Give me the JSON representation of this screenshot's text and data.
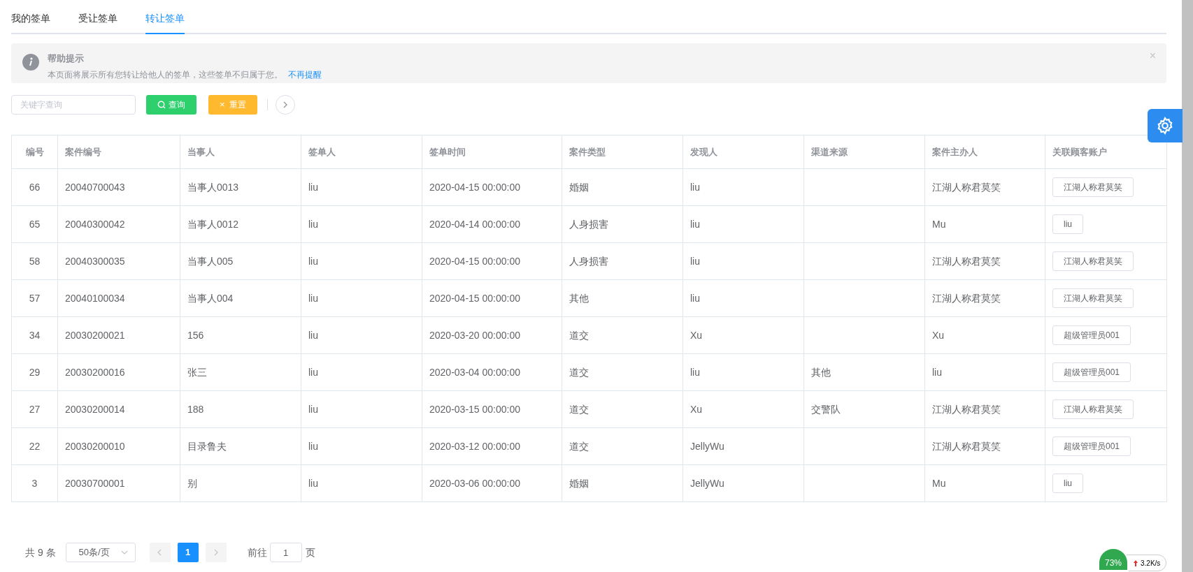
{
  "tabs": [
    {
      "label": "我的签单",
      "selected": false
    },
    {
      "label": "受让签单",
      "selected": false
    },
    {
      "label": "转让签单",
      "selected": true
    }
  ],
  "help_alert": {
    "title": "帮助提示",
    "message": "本页面将展示所有您转让给他人的签单，这些签单不归属于您。",
    "link": "不再提醒",
    "close": "×"
  },
  "toolbar": {
    "search": {
      "placeholder": "关键字查询"
    },
    "query_button": "查询",
    "reset_button": "重置",
    "reset_icon": "×"
  },
  "table": {
    "columns": [
      "编号",
      "案件编号",
      "当事人",
      "签单人",
      "签单时间",
      "案件类型",
      "发现人",
      "渠道来源",
      "案件主办人",
      "关联顾客账户"
    ],
    "rows": [
      [
        "66",
        "20040700043",
        "当事人0013",
        "liu",
        "2020-04-15 00:00:00",
        "婚姻",
        "liu",
        "",
        "江湖人称君莫笑",
        "江湖人称君莫笑"
      ],
      [
        "65",
        "20040300042",
        "当事人0012",
        "liu",
        "2020-04-14 00:00:00",
        "人身损害",
        "liu",
        "",
        "Mu",
        "liu"
      ],
      [
        "58",
        "20040300035",
        "当事人005",
        "liu",
        "2020-04-15 00:00:00",
        "人身损害",
        "liu",
        "",
        "江湖人称君莫笑",
        "江湖人称君莫笑"
      ],
      [
        "57",
        "20040100034",
        "当事人004",
        "liu",
        "2020-04-15 00:00:00",
        "其他",
        "liu",
        "",
        "江湖人称君莫笑",
        "江湖人称君莫笑"
      ],
      [
        "34",
        "20030200021",
        "156",
        "liu",
        "2020-03-20 00:00:00",
        "道交",
        "Xu",
        "",
        "Xu",
        "超级管理员001"
      ],
      [
        "29",
        "20030200016",
        "张三",
        "liu",
        "2020-03-04 00:00:00",
        "道交",
        "liu",
        "其他",
        "liu",
        "超级管理员001"
      ],
      [
        "27",
        "20030200014",
        "188",
        "liu",
        "2020-03-15 00:00:00",
        "道交",
        "Xu",
        "交警队",
        "江湖人称君莫笑",
        "江湖人称君莫笑"
      ],
      [
        "22",
        "20030200010",
        "目录鲁夫",
        "liu",
        "2020-03-12 00:00:00",
        "道交",
        "JellyWu",
        "",
        "江湖人称君莫笑",
        "超级管理员001"
      ],
      [
        "3",
        "20030700001",
        "别",
        "liu",
        "2020-03-06 00:00:00",
        "婚姻",
        "JellyWu",
        "",
        "Mu",
        "liu"
      ]
    ]
  },
  "pagination": {
    "total": "共 9 条",
    "page_size": "50条/页",
    "pages": [
      {
        "label": "1",
        "selected": true
      }
    ],
    "goto_label": "前往",
    "goto_value": "1",
    "goto_suffix": "页"
  },
  "tray_widget": {
    "cpu": "73%",
    "speed": "3.2K/s"
  }
}
